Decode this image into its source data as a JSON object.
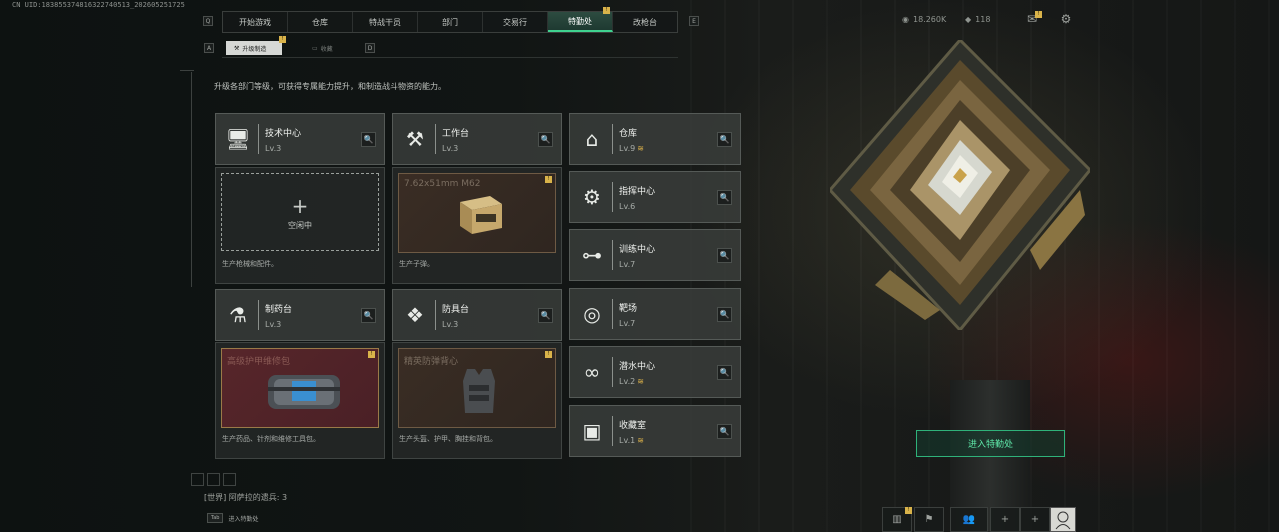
{
  "uid_text": "CN UID:1838553748163227405​13_202605251725",
  "nav": {
    "tabs": [
      {
        "label": "开始游戏"
      },
      {
        "label": "仓库"
      },
      {
        "label": "特战干员"
      },
      {
        "label": "部门"
      },
      {
        "label": "交易行"
      },
      {
        "label": "特勤处",
        "active": true
      },
      {
        "label": "改枪台"
      }
    ],
    "key_left": "Q",
    "key_right": "E"
  },
  "subtabs": {
    "active_label": "升级制造",
    "inactive_label": "收藏",
    "key_left": "A",
    "key_right": "D"
  },
  "description": "升级各部门等级，可获得专属能力提升，和制造战斗物资的能力。",
  "workshops": [
    {
      "name": "技术中心",
      "level": "Lv.3",
      "icon": "computer-icon",
      "slot": {
        "state": "empty",
        "label": "空闲中"
      },
      "footer": "生产枪械和配件。"
    },
    {
      "name": "工作台",
      "level": "Lv.3",
      "icon": "tools-icon",
      "slot": {
        "state": "producing",
        "item": "7.62x51mm M62"
      },
      "footer": "生产子弹。"
    },
    {
      "name": "制药台",
      "level": "Lv.3",
      "icon": "microscope-icon",
      "slot": {
        "state": "producing",
        "item": "高级护甲维修包"
      },
      "footer": "生产药品、针剂和维修工具包。"
    },
    {
      "name": "防具台",
      "level": "Lv.3",
      "icon": "armor-parts-icon",
      "slot": {
        "state": "producing",
        "item": "精英防弹背心"
      },
      "footer": "生产头盔、护甲、胸挂和背包。"
    }
  ],
  "facilities": [
    {
      "name": "仓库",
      "level": "Lv.9",
      "upgradable": true,
      "icon": "warehouse-icon"
    },
    {
      "name": "指挥中心",
      "level": "Lv.6",
      "upgradable": false,
      "icon": "chip-icon"
    },
    {
      "name": "训练中心",
      "level": "Lv.7",
      "upgradable": false,
      "icon": "dumbbell-icon"
    },
    {
      "name": "靶场",
      "level": "Lv.7",
      "upgradable": false,
      "icon": "target-icon"
    },
    {
      "name": "潜水中心",
      "level": "Lv.2",
      "upgradable": true,
      "icon": "goggles-icon"
    },
    {
      "name": "收藏室",
      "level": "Lv.1",
      "upgradable": true,
      "icon": "display-case-icon"
    }
  ],
  "up_glyph": "≋",
  "search_glyph": "🔍",
  "enter_button": "进入特勤处",
  "chat_text": "[世界] 阿萨拉的遗兵: 3",
  "tab_hint": {
    "key": "Tab",
    "label": "进入特勤处"
  },
  "currency": {
    "coins": "18.260K",
    "tickets": "118"
  },
  "colors": {
    "accent": "#3fd28f",
    "badge": "#d9b34a",
    "upgrade": "#e0b44a"
  }
}
